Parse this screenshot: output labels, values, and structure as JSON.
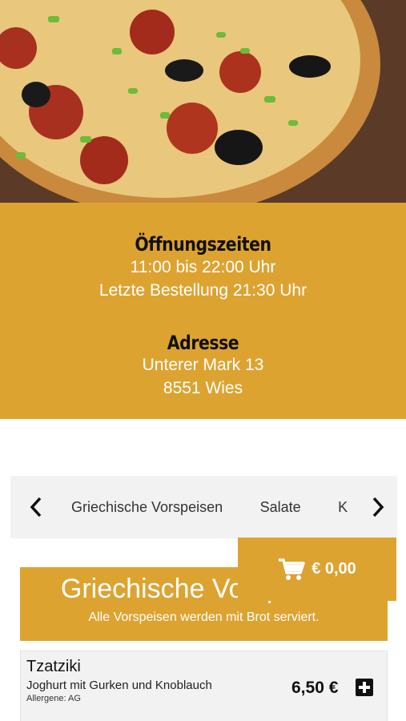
{
  "hero": {
    "image": "pizza-photo"
  },
  "info": {
    "hours_heading": "Öffnungszeiten",
    "hours_line": "11:00 bis 22:00 Uhr",
    "last_order": "Letzte Bestellung 21:30 Uhr",
    "address_heading": "Adresse",
    "street": "Unterer Mark 13",
    "city": "8551 Wies"
  },
  "categories": {
    "prev_icon": "chevron-left-icon",
    "next_icon": "chevron-right-icon",
    "tabs": [
      "Griechische Vorspeisen",
      "Salate",
      "K"
    ]
  },
  "cart": {
    "icon": "cart-icon",
    "amount": "€ 0,00"
  },
  "section": {
    "title": "Griechische Vorspeisen",
    "subtitle": "Alle Vorspeisen werden mit Brot serviert."
  },
  "items": [
    {
      "name": "Tzatziki",
      "description": "Joghurt mit Gurken und Knoblauch",
      "allergens": "Allergene: AG",
      "price": "6,50 €",
      "add_icon": "plus-icon"
    }
  ],
  "colors": {
    "accent": "#dda331",
    "bar": "#f2f2f2"
  }
}
